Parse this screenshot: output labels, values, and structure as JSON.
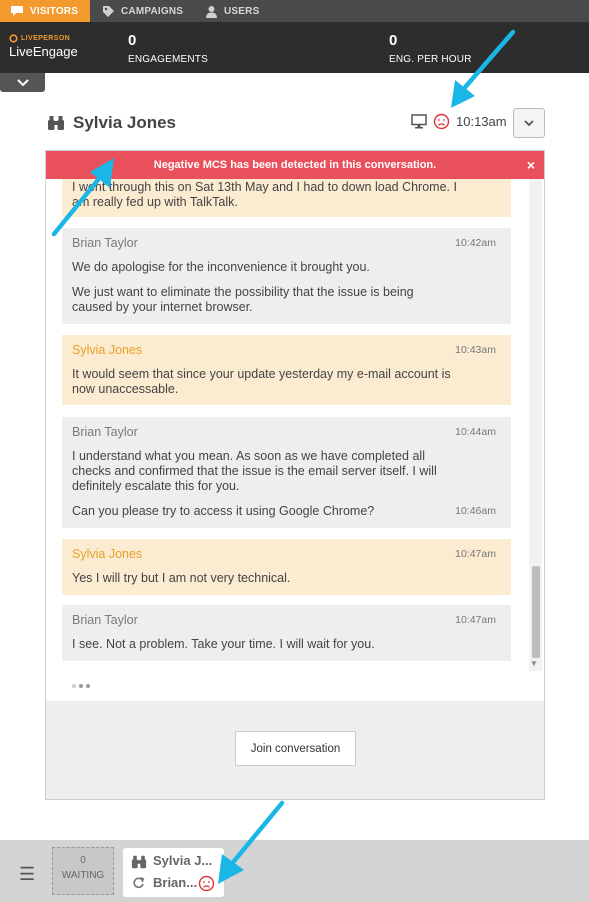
{
  "nav": {
    "items": [
      {
        "label": "VISITORS",
        "icon": "chat-bubble-icon",
        "active": true
      },
      {
        "label": "CAMPAIGNS",
        "icon": "tag-icon",
        "active": false
      },
      {
        "label": "USERS",
        "icon": "user-icon",
        "active": false
      }
    ]
  },
  "header": {
    "brand": "LIVEPERSON",
    "product": "LiveEngage",
    "stats": [
      {
        "value": "0",
        "label": "ENGAGEMENTS"
      },
      {
        "value": "0",
        "label": "ENG. PER HOUR"
      }
    ]
  },
  "visitor": {
    "name": "Sylvia Jones",
    "time": "10:13am",
    "device_icon": "desktop-icon",
    "mood_icon": "sad-face-icon"
  },
  "alert": {
    "text": "Negative MCS has been detected in this conversation.",
    "close": "×"
  },
  "messages": [
    {
      "role": "customer",
      "sender": "",
      "time": "",
      "lines": [
        "I went through this on Sat 13th May and I had to down load Chrome. I am really fed up with TalkTalk."
      ]
    },
    {
      "role": "agent",
      "sender": "Brian Taylor",
      "time": "10:42am",
      "lines": [
        "We do apologise for the inconvenience it brought you.",
        "We just want to eliminate the possibility that the issue is being caused by your internet browser."
      ]
    },
    {
      "role": "customer",
      "sender": "Sylvia Jones",
      "time": "10:43am",
      "lines": [
        "It would seem that since your update yesterday my e-mail account is now unaccessable."
      ]
    },
    {
      "role": "agent",
      "sender": "Brian Taylor",
      "time": "10:44am",
      "time2": "10:46am",
      "lines": [
        "I understand what you mean. As soon as we have completed all checks and confirmed that the issue is the email server itself. I will definitely escalate this for you.",
        "Can you please try to access it using Google Chrome?"
      ]
    },
    {
      "role": "customer",
      "sender": "Sylvia Jones",
      "time": "10:47am",
      "lines": [
        "Yes I will try but I am not very technical."
      ]
    },
    {
      "role": "agent",
      "sender": "Brian Taylor",
      "time": "10:47am",
      "lines": [
        "I see. Not a problem. Take your time. I will wait for you."
      ]
    }
  ],
  "join_button": "Join conversation",
  "bottom": {
    "waiting_count": "0",
    "waiting_label": "WAITING",
    "chat_name": "Sylvia J...",
    "chat_agent": "Brian..."
  },
  "colors": {
    "accent_orange": "#f29a2e",
    "alert_red": "#e8505b",
    "customer_bubble": "#fbebd1",
    "agent_bubble": "#eeeeee",
    "annotation_arrow": "#1ab6e8"
  }
}
